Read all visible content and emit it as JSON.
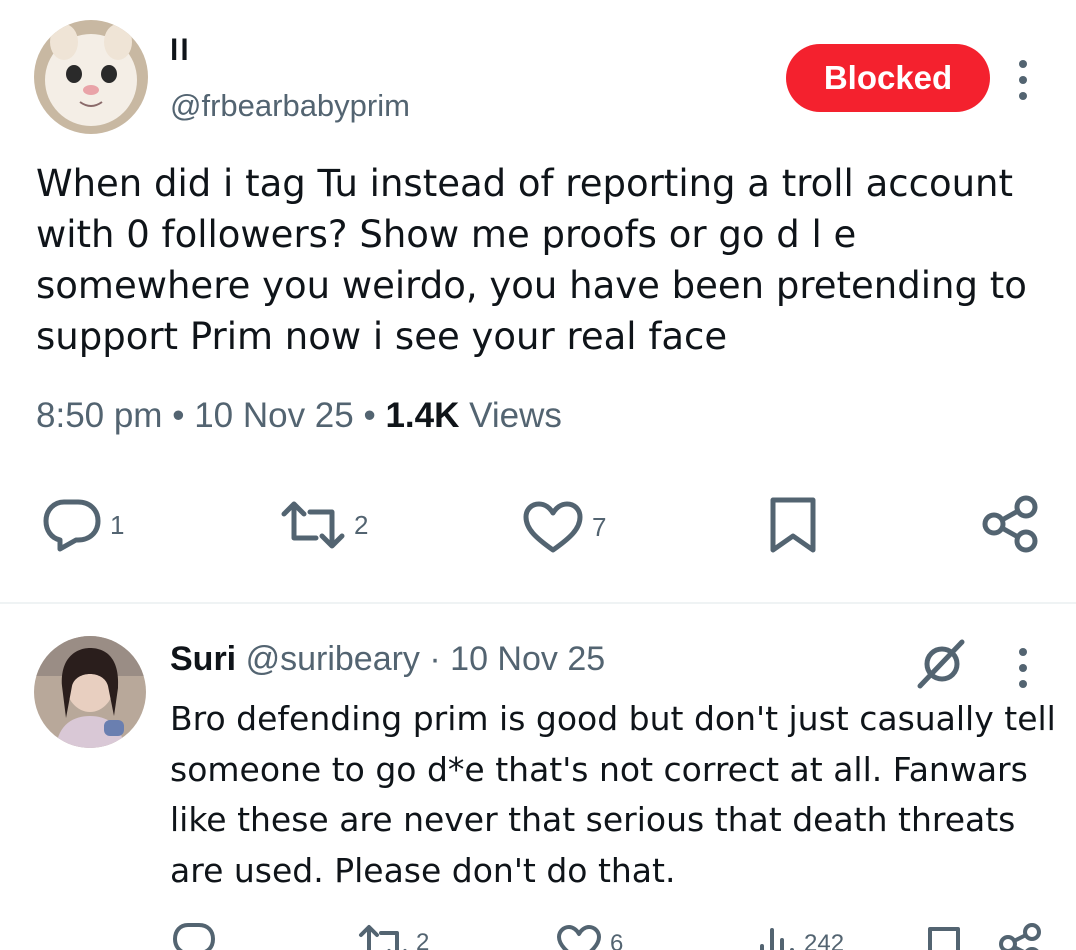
{
  "main_tweet": {
    "author_name": "ll",
    "author_handle": "@frbearbabyprim",
    "blocked_label": "Blocked",
    "text": "When did i tag Tu instead of reporting a troll account with 0 followers? Show me proofs or go d l e somewhere you weirdo, you have been pretending to support Prim now i see your real face",
    "time": "8:50 pm",
    "date": "10 Nov 25",
    "views_count": "1.4K",
    "views_label": "Views",
    "separator": "•",
    "actions": {
      "reply_count": "1",
      "retweet_count": "2",
      "like_count": "7"
    }
  },
  "reply": {
    "author_name": "Suri",
    "author_handle": "@suribeary",
    "separator": "·",
    "date": "10 Nov 25",
    "text": "Bro defending prim is good but don't just casually tell someone to go d*e that's not correct at all. Fanwars like these are never that serious that death threats are used. Please don't do that.",
    "actions": {
      "retweet_count": "2",
      "like_count": "6",
      "views_count": "242"
    }
  },
  "colors": {
    "blocked_red": "#f4212e",
    "secondary_text": "#536471",
    "primary_text": "#0f1419",
    "divider": "#eff3f4"
  },
  "icons": [
    "reply-icon",
    "retweet-icon",
    "like-icon",
    "bookmark-icon",
    "share-icon",
    "more-icon",
    "grok-icon",
    "views-icon"
  ]
}
